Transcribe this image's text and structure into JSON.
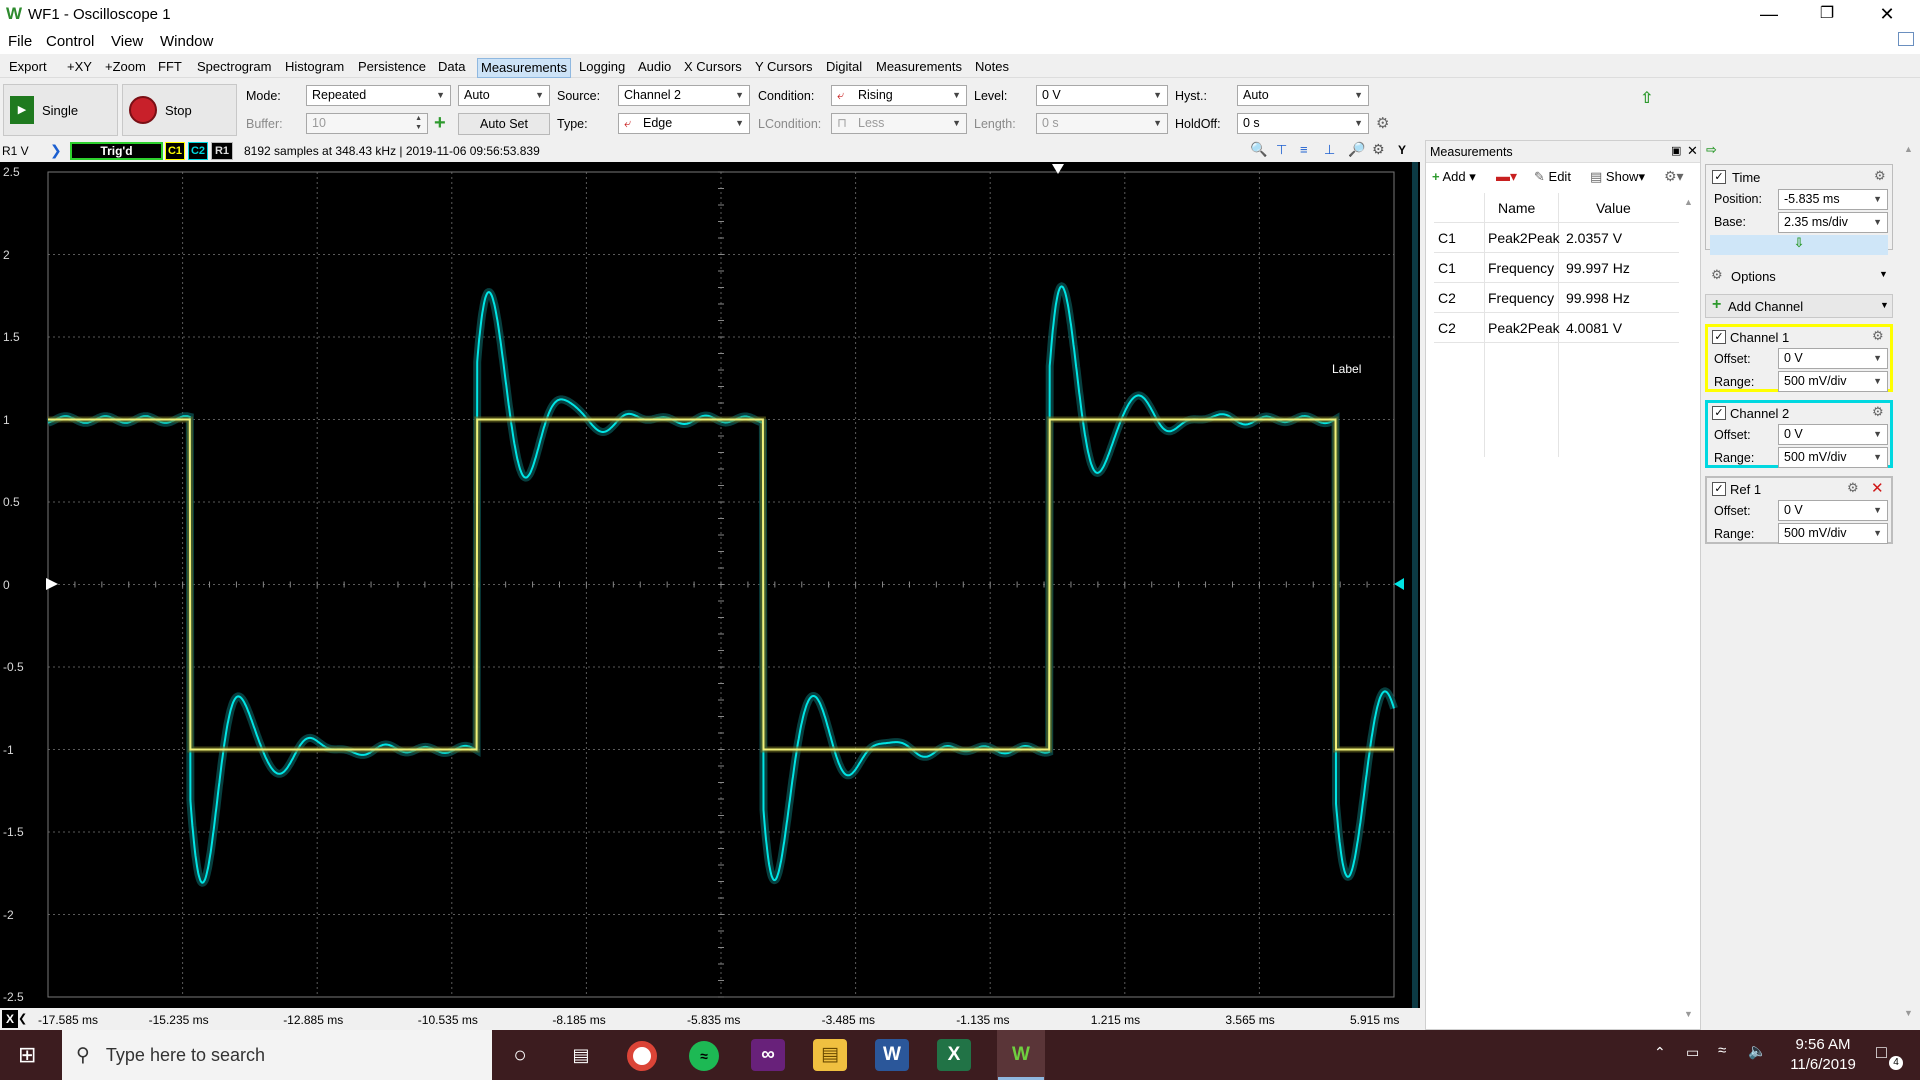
{
  "window": {
    "title": "WF1 - Oscilloscope 1"
  },
  "menu": [
    "File",
    "Control",
    "View",
    "Window"
  ],
  "tabs": [
    "Export",
    "+XY",
    "+Zoom",
    "FFT",
    "Spectrogram",
    "Histogram",
    "Persistence",
    "Data",
    "Measurements",
    "Logging",
    "Audio",
    "X Cursors",
    "Y Cursors",
    "Digital",
    "Measurements",
    "Notes"
  ],
  "active_tab": 8,
  "toolbar": {
    "single_label": "Single",
    "stop_label": "Stop",
    "mode_label": "Mode:",
    "mode_value": "Repeated",
    "auto_value": "Auto",
    "buffer_label": "Buffer:",
    "buffer_value": "10",
    "autoset_label": "Auto Set",
    "source_label": "Source:",
    "source_value": "Channel 2",
    "type_label": "Type:",
    "type_value": "Edge",
    "condition_label": "Condition:",
    "condition_value": "Rising",
    "lcondition_label": "LCondition:",
    "lcondition_value": "Less",
    "level_label": "Level:",
    "level_value": "0 V",
    "length_label": "Length:",
    "length_value": "0 s",
    "hyst_label": "Hyst.:",
    "hyst_value": "Auto",
    "holdoff_label": "HoldOff:",
    "holdoff_value": "0 s"
  },
  "status": {
    "r1v": "R1 V",
    "trig": "Trig'd",
    "c1": "C1",
    "c2": "C2",
    "r1": "R1",
    "info": "8192 samples at 348.43 kHz | 2019-11-06 09:56:53.839"
  },
  "plot": {
    "yticks": [
      "2.5",
      "2",
      "1.5",
      "1",
      "0.5",
      "0",
      "-0.5",
      "-1",
      "-1.5",
      "-2",
      "-2.5"
    ],
    "xticks": [
      "-17.585 ms",
      "-15.235 ms",
      "-12.885 ms",
      "-10.535 ms",
      "-8.185 ms",
      "-5.835 ms",
      "-3.485 ms",
      "-1.135 ms",
      "1.215 ms",
      "3.565 ms",
      "5.915 ms"
    ],
    "label_text": "Label",
    "c1_color": "#f0f07a",
    "c2_color": "#00e5e5"
  },
  "chart_data": {
    "type": "line",
    "xlabel": "",
    "ylabel": "",
    "x_unit": "ms",
    "y_unit": "V",
    "xlim": [
      -17.585,
      5.915
    ],
    "ylim": [
      -2.5,
      2.5
    ],
    "grid": true,
    "series": [
      {
        "name": "C1",
        "type": "square",
        "amplitude": 1.0,
        "frequency_hz": 99.997,
        "rising_edges_ms": [
          -10.1,
          -0.1
        ],
        "falling_edges_ms": [
          -15.1,
          -5.1,
          4.9
        ],
        "peak2peak": "2.0357 V"
      },
      {
        "name": "C2",
        "type": "square with ringing",
        "amplitude": 1.0,
        "overshoot_peak": 2.0,
        "undershoot_peak": -2.0,
        "frequency_hz": 99.998,
        "rising_edges_ms": [
          -10.1,
          -0.1
        ],
        "falling_edges_ms": [
          -15.1,
          -5.1,
          4.9
        ],
        "peak2peak": "4.0081 V"
      }
    ]
  },
  "measurements": {
    "title": "Measurements",
    "add_label": "Add",
    "edit_label": "Edit",
    "show_label": "Show",
    "col_name": "Name",
    "col_value": "Value",
    "rows": [
      {
        "ch": "C1",
        "name": "Peak2Peak",
        "value": "2.0357 V"
      },
      {
        "ch": "C1",
        "name": "Frequency",
        "value": "99.997 Hz"
      },
      {
        "ch": "C2",
        "name": "Frequency",
        "value": "99.998 Hz"
      },
      {
        "ch": "C2",
        "name": "Peak2Peak",
        "value": "4.0081 V"
      }
    ]
  },
  "right": {
    "time_label": "Time",
    "position_label": "Position:",
    "position_value": "-5.835 ms",
    "base_label": "Base:",
    "base_value": "2.35 ms/div",
    "options_label": "Options",
    "add_channel_label": "Add Channel",
    "channels": [
      {
        "name": "Channel 1",
        "offset": "0 V",
        "range": "500 mV/div",
        "color": "#ffff00"
      },
      {
        "name": "Channel 2",
        "offset": "0 V",
        "range": "500 mV/div",
        "color": "#00d8e0"
      },
      {
        "name": "Ref 1",
        "offset": "0 V",
        "range": "500 mV/div",
        "color": "#bdbdbd"
      }
    ],
    "offset_label": "Offset:",
    "range_label": "Range:"
  },
  "taskbar": {
    "search_placeholder": "Type here to search",
    "time": "9:56 AM",
    "date": "11/6/2019",
    "notif_count": "4"
  }
}
